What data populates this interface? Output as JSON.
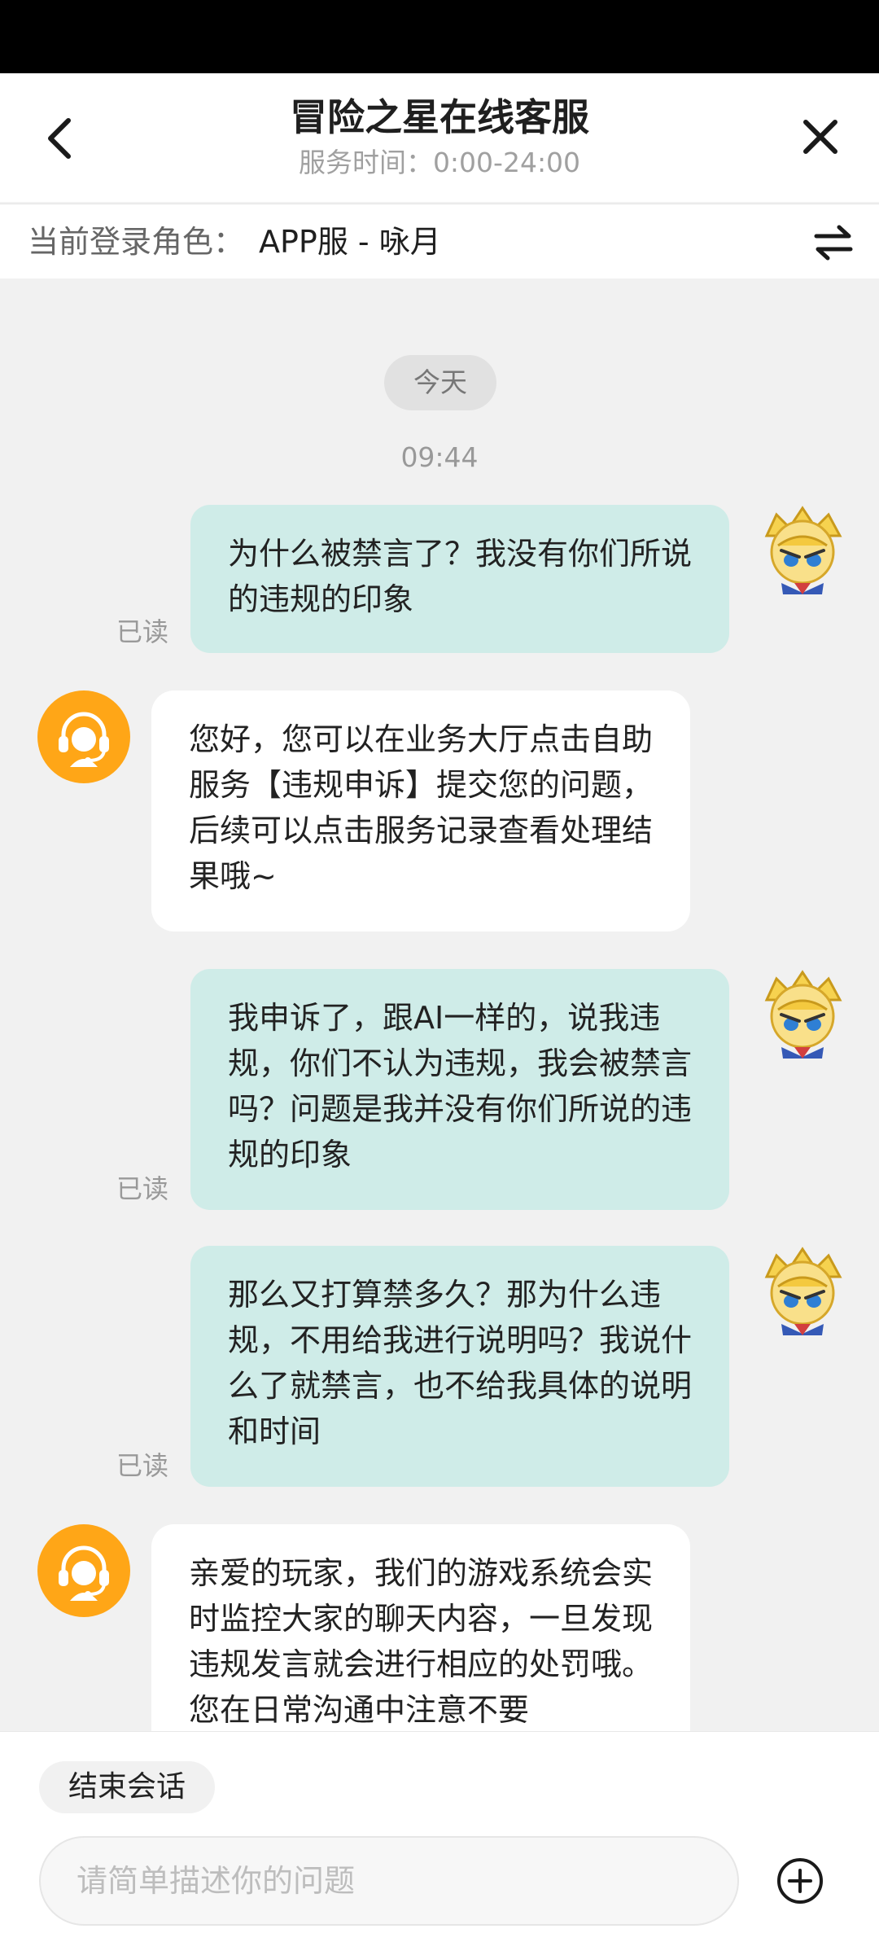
{
  "header": {
    "title": "冒险之星在线客服",
    "service_hours": "服务时间：0:00-24:00",
    "back_icon": "chevron-left-icon",
    "close_icon": "close-icon"
  },
  "role_bar": {
    "label": "当前登录角色：",
    "value": "APP服 - 咏月",
    "switch_icon": "swap-arrows-icon"
  },
  "chat": {
    "date_pill": "今天",
    "time": "09:44",
    "messages": [
      {
        "sender": "user",
        "text": "为什么被禁言了？我没有你们所说的违规的印象",
        "status": "已读"
      },
      {
        "sender": "agent",
        "text": "您好，您可以在业务大厅点击自助服务【违规申诉】提交您的问题，后续可以点击服务记录查看处理结果哦~"
      },
      {
        "sender": "user",
        "text": "我申诉了，跟AI一样的，说我违规，你们不认为违规，我会被禁言吗？问题是我并没有你们所说的违规的印象",
        "status": "已读"
      },
      {
        "sender": "user",
        "text": "那么又打算禁多久？那为什么违规，不用给我进行说明吗？我说什么了就禁言，也不给我具体的说明和时间",
        "status": "已读"
      },
      {
        "sender": "agent",
        "text": "亲爱的玩家，我们的游戏系统会实时监控大家的聊天内容，一旦发现违规发言就会进行相应的处罚哦。您在日常沟通中注意不要"
      }
    ]
  },
  "bottom": {
    "end_session": "结束会话",
    "input_placeholder": "请简单描述你的问题",
    "plus_icon": "plus-circle-icon"
  },
  "colors": {
    "user_bubble": "#cfece8",
    "agent_bubble": "#ffffff",
    "agent_avatar": "#ffa617",
    "chat_background": "#f1f1f1"
  }
}
